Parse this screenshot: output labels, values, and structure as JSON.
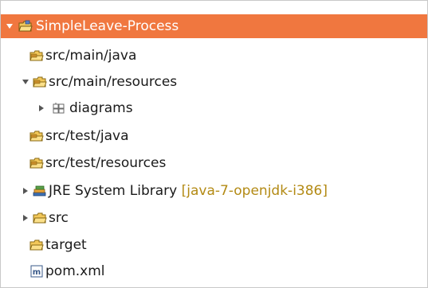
{
  "colors": {
    "selection": "#f0773f",
    "decoration": "#b38a14",
    "folder_fill": "#f3c85a",
    "folder_stroke": "#8a6a14",
    "package_fill": "#e8b64a"
  },
  "tree": {
    "items": [
      {
        "label": "SimpleLeave-Process",
        "icon": "project-folder-icon",
        "twisty": "expanded",
        "selected": true
      },
      {
        "label": "src/main/java",
        "icon": "source-folder-icon"
      },
      {
        "label": "src/main/resources",
        "icon": "source-folder-icon",
        "twisty": "expanded"
      },
      {
        "label": "diagrams",
        "icon": "package-icon",
        "twisty": "collapsed"
      },
      {
        "label": "src/test/java",
        "icon": "source-folder-icon"
      },
      {
        "label": "src/test/resources",
        "icon": "source-folder-icon"
      },
      {
        "label": "JRE System Library",
        "decoration": "[java-7-openjdk-i386]",
        "icon": "library-icon",
        "twisty": "collapsed"
      },
      {
        "label": "src",
        "icon": "folder-icon",
        "twisty": "collapsed"
      },
      {
        "label": "target",
        "icon": "folder-icon"
      },
      {
        "label": "pom.xml",
        "icon": "maven-file-icon"
      }
    ]
  }
}
